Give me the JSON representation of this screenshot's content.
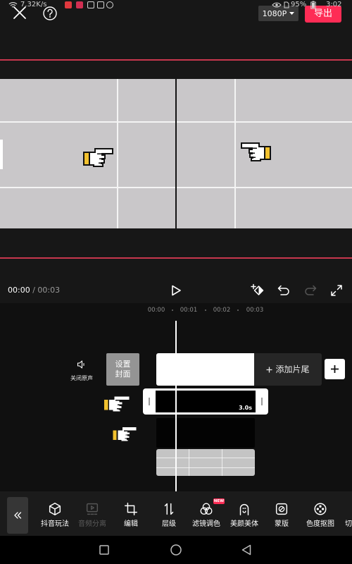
{
  "status_bar": {
    "network_speed": "7.32K/s",
    "battery_percent": "95%",
    "time": "3:02",
    "icons": [
      "wifi-icon",
      "app-notification-icon",
      "eye-icon",
      "sim-icon",
      "battery-icon"
    ]
  },
  "header": {
    "resolution": "1080P",
    "export_label": "导出",
    "icons": [
      "close-icon",
      "help-icon",
      "caret-down-icon"
    ]
  },
  "player": {
    "current_time": "00:00",
    "separator": "/",
    "total_time": "00:03",
    "icons": [
      "play-icon",
      "keyframe-icon",
      "undo-icon",
      "redo-icon",
      "fullscreen-icon"
    ]
  },
  "timeline": {
    "ruler": [
      "00:00",
      "00:01",
      "00:02",
      "00:03"
    ],
    "mute_label": "关闭原声",
    "cover_label": [
      "设置",
      "封面"
    ],
    "add_ending_label": "添加片尾",
    "selected_clip_duration": "3.0s",
    "icons": [
      "speaker-icon",
      "plus-icon",
      "pointing-hand-icon"
    ]
  },
  "toolbar": {
    "collapse_icon": "chevron-double-left-icon",
    "tools": [
      {
        "label": "抖音玩法",
        "icon": "cube-icon",
        "enabled": true
      },
      {
        "label": "音频分离",
        "icon": "audio-separate-icon",
        "enabled": false
      },
      {
        "label": "编辑",
        "icon": "crop-icon",
        "enabled": true
      },
      {
        "label": "层级",
        "icon": "layer-order-icon",
        "enabled": true
      },
      {
        "label": "滤镜调色",
        "icon": "filter-icon",
        "enabled": true,
        "badge": "NEW"
      },
      {
        "label": "美颜美体",
        "icon": "beauty-icon",
        "enabled": true
      },
      {
        "label": "蒙版",
        "icon": "mask-icon",
        "enabled": true
      },
      {
        "label": "色度抠图",
        "icon": "chroma-key-icon",
        "enabled": true
      },
      {
        "label": "切",
        "enabled": true
      }
    ]
  },
  "nav_bar": {
    "icons": [
      "recents-icon",
      "home-icon",
      "back-icon"
    ]
  },
  "colors": {
    "accent": "#fe2c55",
    "guide_line": "#c8374e",
    "background": "#171717",
    "timeline_background": "#101010",
    "toolbar_background": "#1b1b1b",
    "disabled": "#5a5a5a"
  }
}
